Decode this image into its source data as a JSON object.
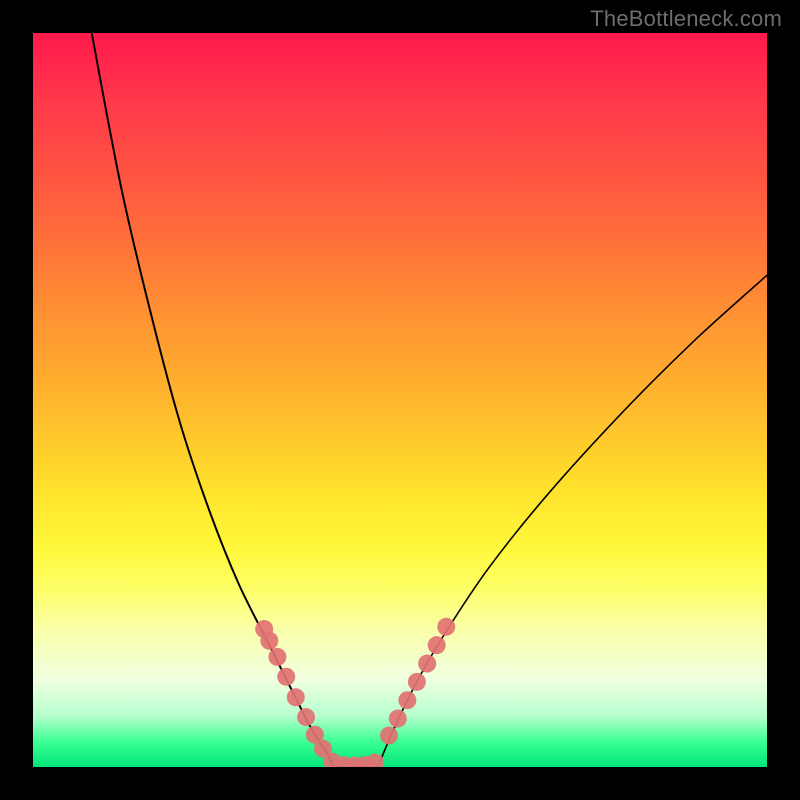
{
  "watermark": "TheBottleneck.com",
  "chart_data": {
    "type": "line",
    "title": "",
    "xlabel": "",
    "ylabel": "",
    "xlim": [
      0,
      100
    ],
    "ylim": [
      0,
      100
    ],
    "grid": false,
    "legend": false,
    "series": [
      {
        "name": "left-curve",
        "x": [
          8,
          12,
          16,
          20,
          24,
          28,
          32,
          34,
          36,
          37.5,
          39,
          40.3,
          41
        ],
        "y": [
          100,
          79,
          62,
          47,
          35,
          25,
          17,
          13,
          9,
          6,
          3.5,
          1.5,
          0
        ]
      },
      {
        "name": "right-curve",
        "x": [
          47,
          48,
          50,
          52.5,
          56,
          62,
          70,
          80,
          90,
          100
        ],
        "y": [
          0,
          2.5,
          7,
          12,
          18,
          27,
          37,
          48,
          58,
          67
        ]
      },
      {
        "name": "valley-floor",
        "x": [
          41,
          43,
          45,
          47
        ],
        "y": [
          0,
          0,
          0,
          0
        ]
      }
    ],
    "markers": {
      "name": "hotspot-dots",
      "left_cluster": {
        "x": [
          31.5,
          32.2,
          33.3,
          34.5,
          35.8,
          37.2,
          38.4,
          39.5
        ],
        "y": [
          18.8,
          17.2,
          15.0,
          12.3,
          9.5,
          6.8,
          4.4,
          2.5
        ]
      },
      "bottom_cluster": {
        "x": [
          40.8,
          42.3,
          43.8,
          45.2,
          46.6
        ],
        "y": [
          0.7,
          0.25,
          0.2,
          0.25,
          0.6
        ]
      },
      "right_cluster": {
        "x": [
          48.5,
          49.7,
          51.0,
          52.3,
          53.7,
          55.0,
          56.3
        ],
        "y": [
          4.3,
          6.6,
          9.1,
          11.6,
          14.1,
          16.6,
          19.1
        ]
      }
    },
    "colors": {
      "curve": "#000000",
      "marker": "#e27272",
      "gradient_top": "#ff1a4d",
      "gradient_bottom": "#00e67a"
    }
  }
}
